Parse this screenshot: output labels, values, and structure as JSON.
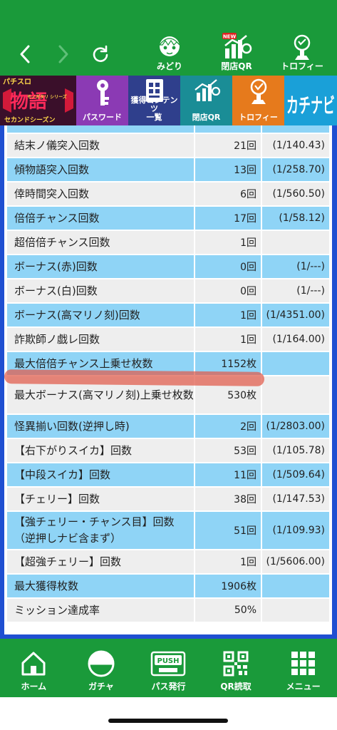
{
  "topbar": {
    "items": [
      {
        "label": "みどり",
        "icon": "character-icon"
      },
      {
        "label": "閉店QR",
        "icon": "chart-icon",
        "badge": "NEW"
      },
      {
        "label": "トロフィー",
        "icon": "trophy-icon"
      }
    ]
  },
  "banner": {
    "logo_top": "パチスロ",
    "logo_main": "物語",
    "logo_side": "モノガタリ シリーズ",
    "logo_bottom": "セカンドシーズン",
    "password": "パスワード",
    "content_line1": "獲得コンテンツ",
    "content_line2": "一覧",
    "close_qr": "閉店QR",
    "trophy": "トロフィー",
    "kachinavi": "カチナビ"
  },
  "table": {
    "rows": [
      {
        "label": "結末ノ儀突入回数",
        "value": "21回",
        "ratio": "(1/140.43)",
        "style": "gray"
      },
      {
        "label": "傾物語突入回数",
        "value": "13回",
        "ratio": "(1/258.70)",
        "style": "blue"
      },
      {
        "label": "倖時間突入回数",
        "value": "6回",
        "ratio": "(1/560.50)",
        "style": "gray"
      },
      {
        "label": "倍倍チャンス回数",
        "value": "17回",
        "ratio": "(1/58.12)",
        "style": "blue"
      },
      {
        "label": "超倍倍チャンス回数",
        "value": "1回",
        "ratio": "",
        "style": "gray"
      },
      {
        "label": "ボーナス(赤)回数",
        "value": "0回",
        "ratio": "(1/---)",
        "style": "blue"
      },
      {
        "label": "ボーナス(白)回数",
        "value": "0回",
        "ratio": "(1/---)",
        "style": "gray"
      },
      {
        "label": "ボーナス(高マリノ刻)回数",
        "value": "1回",
        "ratio": "(1/4351.00)",
        "style": "blue"
      },
      {
        "label": "詐欺師ノ戯レ回数",
        "value": "1回",
        "ratio": "(1/164.00)",
        "style": "gray"
      },
      {
        "label": "最大倍倍チャンス上乗せ枚数",
        "value": "1152枚",
        "ratio": "",
        "style": "blue"
      },
      {
        "label": "最大ボーナス(高マリノ刻)上乗せ枚数",
        "value": "530枚",
        "ratio": "",
        "style": "gray"
      },
      {
        "label": "怪異揃い回数(逆押し時)",
        "value": "2回",
        "ratio": "(1/2803.00)",
        "style": "blue"
      },
      {
        "label": "【右下がりスイカ】回数",
        "value": "53回",
        "ratio": "(1/105.78)",
        "style": "gray"
      },
      {
        "label": "【中段スイカ】回数",
        "value": "11回",
        "ratio": "(1/509.64)",
        "style": "blue"
      },
      {
        "label": "【チェリー】回数",
        "value": "38回",
        "ratio": "(1/147.53)",
        "style": "gray"
      },
      {
        "label": "【強チェリー・チャンス目】回数（逆押しナビ含まず）",
        "value": "51回",
        "ratio": "(1/109.93)",
        "style": "blue"
      },
      {
        "label": "【超強チェリー】回数",
        "value": "1回",
        "ratio": "(1/5606.00)",
        "style": "gray"
      },
      {
        "label": "最大獲得枚数",
        "value": "1906枚",
        "ratio": "",
        "style": "blue"
      },
      {
        "label": "ミッション達成率",
        "value": "50%",
        "ratio": "",
        "style": "gray"
      }
    ]
  },
  "bottombar": {
    "items": [
      {
        "label": "ホーム",
        "icon": "home-icon"
      },
      {
        "label": "ガチャ",
        "icon": "gacha-icon"
      },
      {
        "label": "パス発行",
        "icon": "push-icon",
        "badge": "PUSH"
      },
      {
        "label": "QR読取",
        "icon": "qr-icon"
      },
      {
        "label": "メニュー",
        "icon": "menu-grid-icon"
      }
    ]
  },
  "colors": {
    "nav_green": "#1a9a3a",
    "row_blue": "#8fd4f6",
    "row_gray": "#eeeeee",
    "frame_blue": "#1f4fd1",
    "marker_red": "#e15a4a"
  }
}
